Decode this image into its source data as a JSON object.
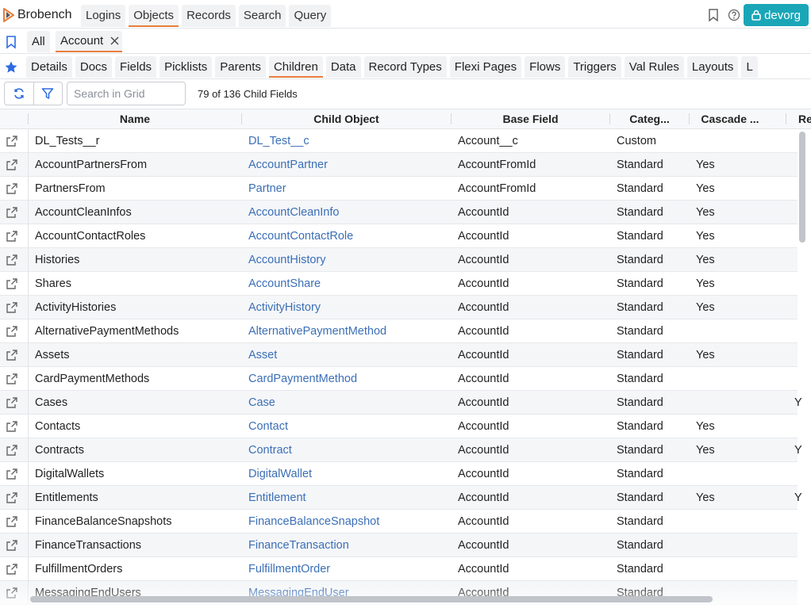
{
  "app": {
    "name": "Brobench"
  },
  "nav": {
    "tabs": [
      "Logins",
      "Objects",
      "Records",
      "Search",
      "Query"
    ],
    "active": "Objects"
  },
  "org_button": {
    "label": "devorg",
    "color": "#1aa6b7"
  },
  "object_tabs": {
    "all_label": "All",
    "current_label": "Account"
  },
  "subtabs": {
    "items": [
      "Details",
      "Docs",
      "Fields",
      "Picklists",
      "Parents",
      "Children",
      "Data",
      "Record Types",
      "Flexi Pages",
      "Flows",
      "Triggers",
      "Val Rules",
      "Layouts",
      "L"
    ],
    "active": "Children"
  },
  "toolbar": {
    "search_placeholder": "Search in Grid",
    "count_text": "79 of 136 Child Fields"
  },
  "grid": {
    "columns": [
      "Name",
      "Child Object",
      "Base Field",
      "Categ...",
      "Cascade ...",
      "Re"
    ],
    "rows": [
      {
        "name": "DL_Tests__r",
        "child": "DL_Test__c",
        "base": "Account__c",
        "category": "Custom",
        "cascade": ""
      },
      {
        "name": "AccountPartnersFrom",
        "child": "AccountPartner",
        "base": "AccountFromId",
        "category": "Standard",
        "cascade": "Yes"
      },
      {
        "name": "PartnersFrom",
        "child": "Partner",
        "base": "AccountFromId",
        "category": "Standard",
        "cascade": "Yes"
      },
      {
        "name": "AccountCleanInfos",
        "child": "AccountCleanInfo",
        "base": "AccountId",
        "category": "Standard",
        "cascade": "Yes"
      },
      {
        "name": "AccountContactRoles",
        "child": "AccountContactRole",
        "base": "AccountId",
        "category": "Standard",
        "cascade": "Yes"
      },
      {
        "name": "Histories",
        "child": "AccountHistory",
        "base": "AccountId",
        "category": "Standard",
        "cascade": "Yes"
      },
      {
        "name": "Shares",
        "child": "AccountShare",
        "base": "AccountId",
        "category": "Standard",
        "cascade": "Yes"
      },
      {
        "name": "ActivityHistories",
        "child": "ActivityHistory",
        "base": "AccountId",
        "category": "Standard",
        "cascade": "Yes"
      },
      {
        "name": "AlternativePaymentMethods",
        "child": "AlternativePaymentMethod",
        "base": "AccountId",
        "category": "Standard",
        "cascade": ""
      },
      {
        "name": "Assets",
        "child": "Asset",
        "base": "AccountId",
        "category": "Standard",
        "cascade": "Yes"
      },
      {
        "name": "CardPaymentMethods",
        "child": "CardPaymentMethod",
        "base": "AccountId",
        "category": "Standard",
        "cascade": ""
      },
      {
        "name": "Cases",
        "child": "Case",
        "base": "AccountId",
        "category": "Standard",
        "cascade": "",
        "rel": "Y"
      },
      {
        "name": "Contacts",
        "child": "Contact",
        "base": "AccountId",
        "category": "Standard",
        "cascade": "Yes"
      },
      {
        "name": "Contracts",
        "child": "Contract",
        "base": "AccountId",
        "category": "Standard",
        "cascade": "Yes",
        "rel": "Y"
      },
      {
        "name": "DigitalWallets",
        "child": "DigitalWallet",
        "base": "AccountId",
        "category": "Standard",
        "cascade": ""
      },
      {
        "name": "Entitlements",
        "child": "Entitlement",
        "base": "AccountId",
        "category": "Standard",
        "cascade": "Yes",
        "rel": "Y"
      },
      {
        "name": "FinanceBalanceSnapshots",
        "child": "FinanceBalanceSnapshot",
        "base": "AccountId",
        "category": "Standard",
        "cascade": ""
      },
      {
        "name": "FinanceTransactions",
        "child": "FinanceTransaction",
        "base": "AccountId",
        "category": "Standard",
        "cascade": ""
      },
      {
        "name": "FulfillmentOrders",
        "child": "FulfillmentOrder",
        "base": "AccountId",
        "category": "Standard",
        "cascade": ""
      },
      {
        "name": "MessagingEndUsers",
        "child": "MessagingEndUser",
        "base": "AccountId",
        "category": "Standard",
        "cascade": ""
      }
    ]
  },
  "colors": {
    "accent": "#e97d3b",
    "link": "#3b6fb6",
    "icon": "#2d6cdf"
  }
}
